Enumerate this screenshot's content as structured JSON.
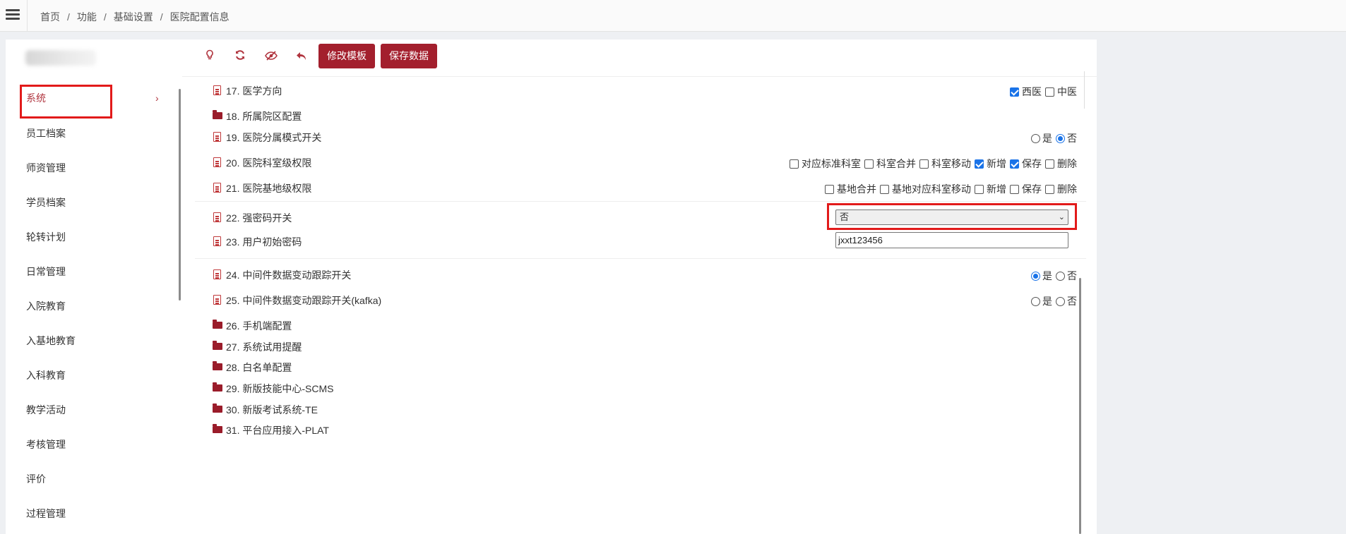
{
  "breadcrumb": [
    "首页",
    "功能",
    "基础设置",
    "医院配置信息"
  ],
  "sidebar": {
    "items": [
      {
        "label": "系统",
        "active": true
      },
      {
        "label": "员工档案"
      },
      {
        "label": "师资管理"
      },
      {
        "label": "学员档案"
      },
      {
        "label": "轮转计划"
      },
      {
        "label": "日常管理"
      },
      {
        "label": "入院教育"
      },
      {
        "label": "入基地教育"
      },
      {
        "label": "入科教育"
      },
      {
        "label": "教学活动"
      },
      {
        "label": "考核管理"
      },
      {
        "label": "评价"
      },
      {
        "label": "过程管理"
      }
    ],
    "chevron": "›"
  },
  "toolbar": {
    "icons": [
      "lightbulb-icon",
      "refresh-icon",
      "eye-slash-icon",
      "undo-icon"
    ],
    "modify_template_label": "修改模板",
    "save_data_label": "保存数据"
  },
  "rows": {
    "r17": {
      "label": "17. 医学方向",
      "icon": "document",
      "options": [
        {
          "type": "checkbox",
          "label": "西医",
          "checked": true
        },
        {
          "type": "checkbox",
          "label": "中医",
          "checked": false
        }
      ]
    },
    "r18": {
      "label": "18. 所属院区配置",
      "icon": "folder"
    },
    "r19": {
      "label": "19. 医院分属模式开关",
      "icon": "document",
      "options": [
        {
          "type": "radio",
          "label": "是",
          "checked": false
        },
        {
          "type": "radio",
          "label": "否",
          "checked": true
        }
      ]
    },
    "r20": {
      "label": "20. 医院科室级权限",
      "icon": "document",
      "options": [
        {
          "type": "checkbox",
          "label": "对应标准科室",
          "checked": false
        },
        {
          "type": "checkbox",
          "label": "科室合并",
          "checked": false
        },
        {
          "type": "checkbox",
          "label": "科室移动",
          "checked": false
        },
        {
          "type": "checkbox",
          "label": "新增",
          "checked": true
        },
        {
          "type": "checkbox",
          "label": "保存",
          "checked": true
        },
        {
          "type": "checkbox",
          "label": "删除",
          "checked": false
        }
      ]
    },
    "r21": {
      "label": "21. 医院基地级权限",
      "icon": "document",
      "options": [
        {
          "type": "checkbox",
          "label": "基地合并",
          "checked": false
        },
        {
          "type": "checkbox",
          "label": "基地对应科室移动",
          "checked": false
        },
        {
          "type": "checkbox",
          "label": "新增",
          "checked": false
        },
        {
          "type": "checkbox",
          "label": "保存",
          "checked": false
        },
        {
          "type": "checkbox",
          "label": "删除",
          "checked": false
        }
      ]
    },
    "r22": {
      "label": "22. 强密码开关",
      "icon": "document",
      "select_value": "否"
    },
    "r23": {
      "label": "23. 用户初始密码",
      "icon": "document",
      "input_value": "jxxt123456"
    },
    "r24": {
      "label": "24. 中间件数据变动跟踪开关",
      "icon": "document",
      "options": [
        {
          "type": "radio",
          "label": "是",
          "checked": true
        },
        {
          "type": "radio",
          "label": "否",
          "checked": false
        }
      ]
    },
    "r25": {
      "label": "25. 中间件数据变动跟踪开关(kafka)",
      "icon": "document",
      "options": [
        {
          "type": "radio",
          "label": "是",
          "checked": false
        },
        {
          "type": "radio",
          "label": "否",
          "checked": false
        }
      ]
    },
    "r26": {
      "label": "26. 手机端配置",
      "icon": "folder"
    },
    "r27": {
      "label": "27. 系统试用提醒",
      "icon": "folder"
    },
    "r28": {
      "label": "28. 白名单配置",
      "icon": "folder"
    },
    "r29": {
      "label": "29. 新版技能中心-SCMS",
      "icon": "folder"
    },
    "r30": {
      "label": "30. 新版考试系统-TE",
      "icon": "folder"
    },
    "r31": {
      "label": "31. 平台应用接入-PLAT",
      "icon": "folder"
    }
  },
  "colors": {
    "accent": "#a31f2d",
    "highlight": "#e21a1a",
    "check": "#1a73e8"
  }
}
